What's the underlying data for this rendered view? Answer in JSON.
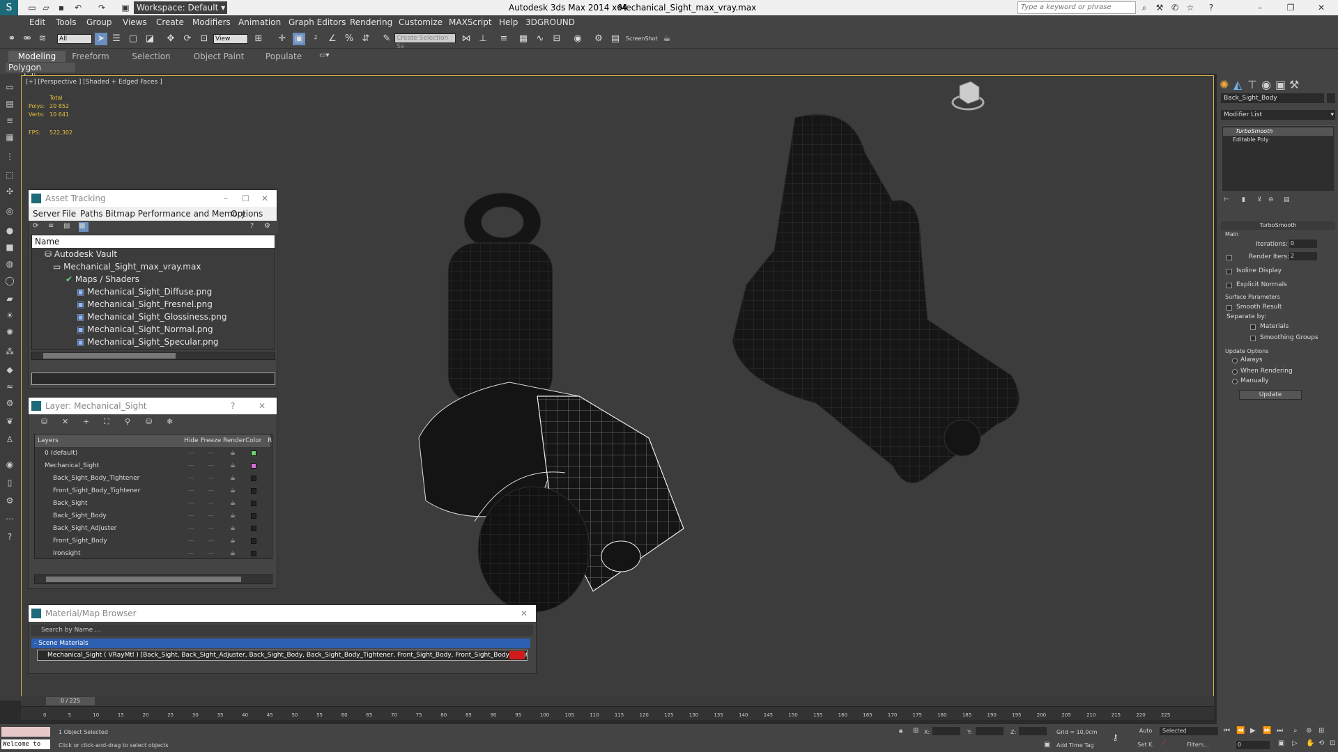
{
  "app": {
    "title": "Autodesk 3ds Max  2014 x64",
    "file": "Mechanical_Sight_max_vray.max",
    "workspace": "Workspace: Default",
    "search_placeholder": "Type a keyword or phrase"
  },
  "menu": [
    "Edit",
    "Tools",
    "Group",
    "Views",
    "Create",
    "Modifiers",
    "Animation",
    "Graph Editors",
    "Rendering",
    "Customize",
    "MAXScript",
    "Help",
    "3DGROUND"
  ],
  "toolbar": {
    "filter": "All",
    "view": "View",
    "selection_set": "Create Selection Se",
    "screenshot": "ScreenShot"
  },
  "ribbon": {
    "tabs": [
      "Modeling",
      "Freeform",
      "Selection",
      "Object Paint",
      "Populate"
    ],
    "sub": "Polygon Modeling"
  },
  "viewport": {
    "label": "[+] [Perspective ] [Shaded + Edged Faces ]",
    "total": "Total",
    "polys_label": "Polys:",
    "polys": "20 852",
    "verts_label": "Verts:",
    "verts": "10 641",
    "fps_label": "FPS:",
    "fps": "522,302"
  },
  "asset_tracking": {
    "title": "Asset Tracking",
    "menu": [
      "Server",
      "File",
      "Paths",
      "Bitmap Performance and Memory",
      "Options"
    ],
    "col_name": "Name",
    "rows": [
      "Autodesk Vault",
      "Mechanical_Sight_max_vray.max",
      "Maps / Shaders",
      "Mechanical_Sight_Diffuse.png",
      "Mechanical_Sight_Fresnel.png",
      "Mechanical_Sight_Glossiness.png",
      "Mechanical_Sight_Normal.png",
      "Mechanical_Sight_Specular.png"
    ]
  },
  "layer_panel": {
    "title": "Layer: Mechanical_Sight",
    "help": "?",
    "cols": [
      "Layers",
      "Hide",
      "Freeze",
      "Render",
      "Color",
      "R"
    ],
    "rows": [
      "0 (default)",
      "Mechanical_Sight",
      "Back_Sight_Body_Tightener",
      "Front_Sight_Body_Tightener",
      "Back_Sight",
      "Back_Sight_Body",
      "Back_Sight_Adjuster",
      "Front_Sight_Body",
      "Ironsight"
    ],
    "colors": [
      "#6fd26f",
      "#d66fd6",
      "#222222",
      "#222222",
      "#222222",
      "#222222",
      "#222222",
      "#222222",
      "#222222"
    ]
  },
  "material_browser": {
    "title": "Material/Map Browser",
    "search_placeholder": "Search by Name ...",
    "group": "- Scene Materials",
    "item": "Mechanical_Sight ( VRayMtl ) [Back_Sight, Back_Sight_Adjuster, Back_Sight_Body, Back_Sight_Body_Tightener, Front_Sight_Body, Front_Sight_Body_Tightener, Ironsight]",
    "swatch_color": "#d11a1a"
  },
  "command_panel": {
    "object_name": "Back_Sight_Body",
    "modifier_list": "Modifier List",
    "stack": [
      "TurboSmooth",
      "Editable Poly"
    ],
    "rollout": "TurboSmooth",
    "main": "Main",
    "iterations_label": "Iterations:",
    "iterations": "0",
    "render_iters_label": "Render Iters:",
    "render_iters": "2",
    "isoline": "Isoline Display",
    "explicit_normals": "Explicit Normals",
    "surface_params": "Surface Parameters",
    "smooth_result": "Smooth Result",
    "separate_by": "Separate by:",
    "materials": "Materials",
    "smoothing_groups": "Smoothing Groups",
    "update_options": "Update Options",
    "always": "Always",
    "when_rendering": "When Rendering",
    "manually": "Manually",
    "update": "Update"
  },
  "timeline": {
    "frame": "0 / 225",
    "ticks": [
      "0",
      "5",
      "10",
      "15",
      "20",
      "25",
      "30",
      "35",
      "40",
      "45",
      "50",
      "55",
      "60",
      "65",
      "70",
      "75",
      "80",
      "85",
      "90",
      "95",
      "100",
      "105",
      "110",
      "115",
      "120",
      "125",
      "130",
      "135",
      "140",
      "145",
      "150",
      "155",
      "160",
      "165",
      "170",
      "175",
      "180",
      "185",
      "190",
      "195",
      "200",
      "205",
      "210",
      "215",
      "220",
      "225"
    ]
  },
  "status": {
    "listener": "Welcome to",
    "selected": "1 Object Selected",
    "hint": "Click or click-and-drag to select objects",
    "x": "X:",
    "y": "Y:",
    "z": "Z:",
    "grid": "Grid = 10,0cm",
    "add_time_tag": "Add Time Tag",
    "auto": "Auto",
    "set_k": "Set K.",
    "key_mode": "Selected",
    "filters": "Filters...",
    "frame_field": "0"
  }
}
